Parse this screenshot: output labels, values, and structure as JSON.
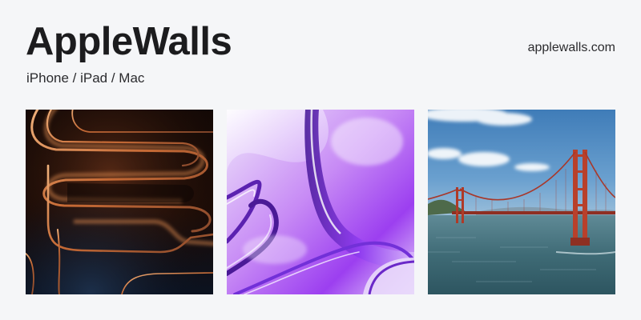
{
  "header": {
    "title": "AppleWalls",
    "tagline": "iPhone / iPad / Mac",
    "link_text": "applewalls.com"
  },
  "gallery": {
    "items": [
      {
        "subject": "copper glowing abstract curves on black",
        "icon": "abstract-wallpaper-icon",
        "accent": "#d9824b"
      },
      {
        "subject": "purple glossy abstract shapes",
        "icon": "abstract-wallpaper-icon",
        "accent": "#a25cf0"
      },
      {
        "subject": "Golden Gate Bridge over the bay",
        "icon": "landscape-photo-icon",
        "accent": "#b8442e"
      }
    ]
  },
  "colors": {
    "background": "#f5f6f8",
    "text": "#1c1c1e"
  }
}
